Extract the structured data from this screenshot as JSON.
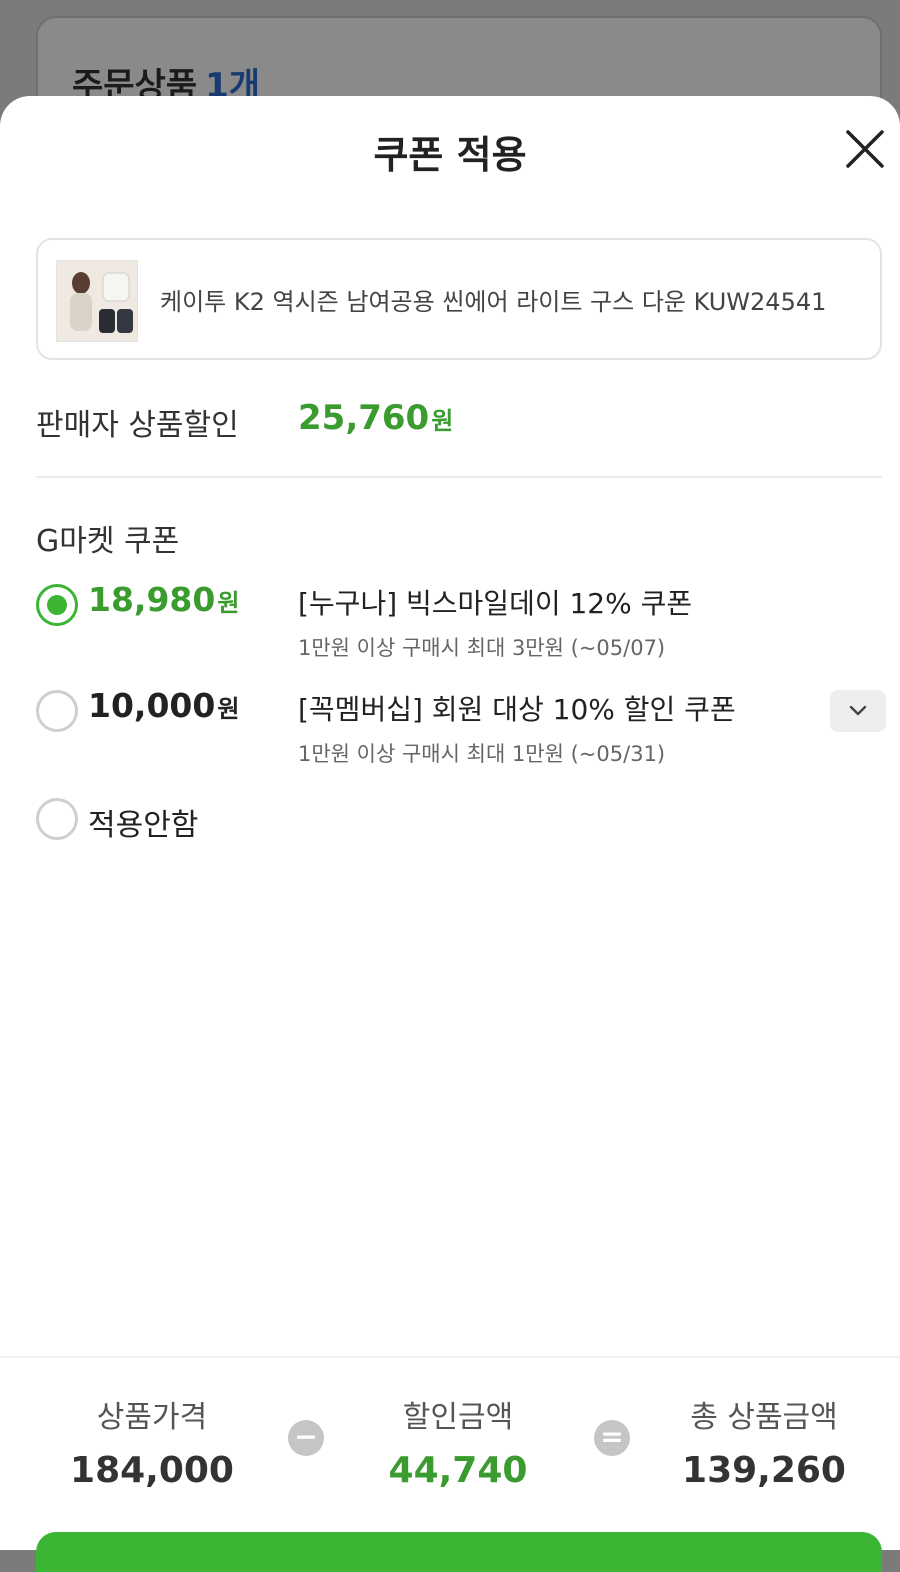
{
  "background": {
    "title": "주문상품",
    "count": "1개"
  },
  "sheet": {
    "title": "쿠폰 적용"
  },
  "product": {
    "name": "케이투 K2 역시즌 남여공용 씬에어 라이트 구스 다운 KUW24541"
  },
  "seller_discount": {
    "label": "판매자 상품할인",
    "amount": "25,760",
    "unit": "원"
  },
  "gmarket": {
    "section_title": "G마켓 쿠폰",
    "coupons": [
      {
        "amount": "18,980",
        "unit": "원",
        "title": "[누구나] 빅스마일데이 12% 쿠폰",
        "desc": "1만원 이상 구매시 최대 3만원 (~05/07)",
        "selected": true
      },
      {
        "amount": "10,000",
        "unit": "원",
        "title": "[꼭멤버십] 회원 대상 10% 할인 쿠폰",
        "desc": "1만원 이상 구매시 최대 1만원 (~05/31)",
        "selected": false
      }
    ],
    "none_label": "적용안함"
  },
  "summary": {
    "price_label": "상품가격",
    "price_value": "184,000",
    "discount_label": "할인금액",
    "discount_value": "44,740",
    "total_label": "총 상품금액",
    "total_value": "139,260",
    "minus": "−",
    "equals": "="
  },
  "colors": {
    "accent_green": "#3cb534",
    "amount_green": "#3a9b2e"
  }
}
